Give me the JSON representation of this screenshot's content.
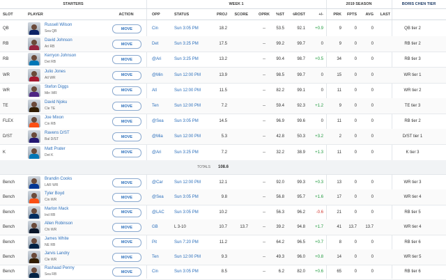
{
  "header": {
    "starters": "STARTERS",
    "week": "WEEK 1",
    "season": "2019 SEASON",
    "tier_source": "BORIS CHEN TIER",
    "columns": {
      "slot": "SLOT",
      "player": "PLAYER",
      "action": "ACTION",
      "opp": "OPP",
      "status": "STATUS",
      "proj": "PROJ",
      "score": "SCORE",
      "oprk": "OPRK",
      "pst": "%ST",
      "prost": "%ROST",
      "pm": "+/-",
      "prk": "PRK",
      "fpts": "FPTS",
      "avg": "AVG",
      "last": "LAST"
    }
  },
  "move_label": "MOVE",
  "totals": {
    "label": "TOTALS",
    "value": "108.6"
  },
  "starters": [
    {
      "slot": "QB",
      "name": "Russell Wilson",
      "meta": "Sea  QB",
      "opp": "Cin",
      "status": "Sun 3:05 PM",
      "proj": "18.2",
      "score": "",
      "oprk": "--",
      "pst": "53.5",
      "prost": "92.1",
      "pm": "+0.9",
      "prk": "9",
      "fpts": "0",
      "avg": "0",
      "last": "",
      "tier": "QB tier 2",
      "jersey": "#0b2265"
    },
    {
      "slot": "RB",
      "name": "David Johnson",
      "meta": "Ari  RB",
      "opp": "Det",
      "status": "Sun 3:25 PM",
      "proj": "17.5",
      "score": "",
      "oprk": "--",
      "pst": "99.2",
      "prost": "99.7",
      "pm": "0",
      "prk": "9",
      "fpts": "0",
      "avg": "0",
      "last": "",
      "tier": "RB tier 2",
      "jersey": "#97233f"
    },
    {
      "slot": "RB",
      "name": "Kerryon Johnson",
      "meta": "Det  RB",
      "opp": "@Ari",
      "status": "Sun 3:25 PM",
      "proj": "13.2",
      "score": "",
      "oprk": "--",
      "pst": "90.4",
      "prost": "98.7",
      "pm": "+0.5",
      "prk": "34",
      "fpts": "0",
      "avg": "0",
      "last": "",
      "tier": "RB tier 3",
      "jersey": "#0076b6"
    },
    {
      "slot": "WR",
      "name": "Julio Jones",
      "meta": "Atl  WR",
      "opp": "@Min",
      "status": "Sun 12:00 PM",
      "proj": "13.9",
      "score": "",
      "oprk": "--",
      "pst": "98.5",
      "prost": "99.7",
      "pm": "0",
      "prk": "15",
      "fpts": "0",
      "avg": "0",
      "last": "",
      "tier": "WR tier 1",
      "jersey": "#a71930"
    },
    {
      "slot": "WR",
      "name": "Stefon Diggs",
      "meta": "Min  WR",
      "opp": "Atl",
      "status": "Sun 12:00 PM",
      "proj": "11.5",
      "score": "",
      "oprk": "--",
      "pst": "82.2",
      "prost": "99.1",
      "pm": "0",
      "prk": "11",
      "fpts": "0",
      "avg": "0",
      "last": "",
      "tier": "WR tier 2",
      "jersey": "#4f2683"
    },
    {
      "slot": "TE",
      "name": "David Njoku",
      "meta": "Cle  TE",
      "opp": "Ten",
      "status": "Sun 12:00 PM",
      "proj": "7.2",
      "score": "",
      "oprk": "--",
      "pst": "59.4",
      "prost": "92.3",
      "pm": "+1.2",
      "prk": "9",
      "fpts": "0",
      "avg": "0",
      "last": "",
      "tier": "TE tier 3",
      "jersey": "#311d00"
    },
    {
      "slot": "FLEX",
      "name": "Joe Mixon",
      "meta": "Cin  RB",
      "opp": "@Sea",
      "status": "Sun 3:05 PM",
      "proj": "14.5",
      "score": "",
      "oprk": "--",
      "pst": "96.9",
      "prost": "99.6",
      "pm": "0",
      "prk": "11",
      "fpts": "0",
      "avg": "0",
      "last": "",
      "tier": "RB tier 2",
      "jersey": "#fb4f14"
    },
    {
      "slot": "D/ST",
      "name": "Ravens D/ST",
      "meta": "Bal  D/ST",
      "opp": "@Mia",
      "status": "Sun 12:00 PM",
      "proj": "5.3",
      "score": "",
      "oprk": "--",
      "pst": "42.8",
      "prost": "50.3",
      "pm": "+3.2",
      "prk": "2",
      "fpts": "0",
      "avg": "0",
      "last": "",
      "tier": "D/ST tier 1",
      "jersey": "#241773"
    },
    {
      "slot": "K",
      "name": "Matt Prater",
      "meta": "Det  K",
      "opp": "@Ari",
      "status": "Sun 3:25 PM",
      "proj": "7.2",
      "score": "",
      "oprk": "--",
      "pst": "32.2",
      "prost": "38.9",
      "pm": "+1.3",
      "prk": "11",
      "fpts": "0",
      "avg": "0",
      "last": "",
      "tier": "K tier 3",
      "jersey": "#0076b6"
    }
  ],
  "bench": [
    {
      "slot": "Bench",
      "name": "Brandin Cooks",
      "meta": "LAR  WR",
      "opp": "@Car",
      "status": "Sun 12:00 PM",
      "proj": "12.1",
      "score": "",
      "oprk": "--",
      "pst": "92.0",
      "prost": "99.3",
      "pm": "+0.3",
      "prk": "13",
      "fpts": "0",
      "avg": "0",
      "last": "",
      "tier": "WR tier 3",
      "jersey": "#003594"
    },
    {
      "slot": "Bench",
      "name": "Tyler Boyd",
      "meta": "Cin  WR",
      "opp": "@Sea",
      "status": "Sun 3:05 PM",
      "proj": "9.8",
      "score": "",
      "oprk": "--",
      "pst": "56.8",
      "prost": "95.7",
      "pm": "+1.6",
      "prk": "17",
      "fpts": "0",
      "avg": "0",
      "last": "",
      "tier": "WR tier 4",
      "jersey": "#fb4f14"
    },
    {
      "slot": "Bench",
      "name": "Marlon Mack",
      "meta": "Ind  RB",
      "opp": "@LAC",
      "status": "Sun 3:05 PM",
      "proj": "10.2",
      "score": "",
      "oprk": "--",
      "pst": "56.3",
      "prost": "96.2",
      "pm": "-0.6",
      "prk": "21",
      "fpts": "0",
      "avg": "0",
      "last": "",
      "tier": "RB tier 5",
      "jersey": "#002c5f"
    },
    {
      "slot": "Bench",
      "name": "Allen Robinson",
      "meta": "Chi  WR",
      "opp": "GB",
      "status": "L 3-10",
      "proj": "10.7",
      "score": "13.7",
      "oprk": "--",
      "pst": "39.2",
      "prost": "94.8",
      "pm": "+1.7",
      "prk": "41",
      "fpts": "13.7",
      "avg": "13.7",
      "last": "",
      "tier": "WR tier 4",
      "jersey": "#0b162a"
    },
    {
      "slot": "Bench",
      "name": "James White",
      "meta": "NE  RB",
      "opp": "Pit",
      "status": "Sun 7:20 PM",
      "proj": "11.2",
      "score": "",
      "oprk": "--",
      "pst": "64.2",
      "prost": "96.5",
      "pm": "+0.7",
      "prk": "8",
      "fpts": "0",
      "avg": "0",
      "last": "",
      "tier": "RB tier 6",
      "jersey": "#002244"
    },
    {
      "slot": "Bench",
      "name": "Jarvis Landry",
      "meta": "Cle  WR",
      "opp": "Ten",
      "status": "Sun 12:00 PM",
      "proj": "9.3",
      "score": "",
      "oprk": "--",
      "pst": "49.3",
      "prost": "96.0",
      "pm": "+0.8",
      "prk": "14",
      "fpts": "0",
      "avg": "0",
      "last": "",
      "tier": "WR tier 5",
      "jersey": "#311d00"
    },
    {
      "slot": "Bench",
      "name": "Rashaad Penny",
      "meta": "Sea  RB",
      "opp": "Cin",
      "status": "Sun 3:05 PM",
      "proj": "8.5",
      "score": "",
      "oprk": "--",
      "pst": "6.2",
      "prost": "82.0",
      "pm": "+0.6",
      "prk": "65",
      "fpts": "0",
      "avg": "0",
      "last": "",
      "tier": "RB tier 6",
      "jersey": "#002244"
    }
  ]
}
